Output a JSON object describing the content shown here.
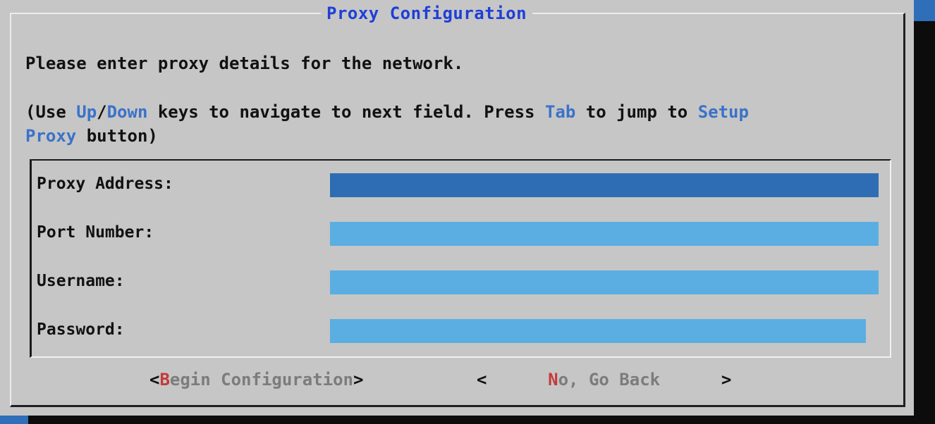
{
  "dialog": {
    "title": "Proxy Configuration",
    "intro": "Please enter proxy details for the network.",
    "help": {
      "p1": "(Use ",
      "up": "Up",
      "slash": "/",
      "down": "Down",
      "p2": " keys to navigate to next field. Press ",
      "tab": "Tab",
      "p3": " to jump to ",
      "setup": "Setup",
      "proxy": "Proxy",
      "p4": " button)"
    }
  },
  "fields": {
    "proxy_address": {
      "label": "Proxy Address:",
      "value": ""
    },
    "port_number": {
      "label": "Port Number:",
      "value": ""
    },
    "username": {
      "label": "Username:",
      "value": ""
    },
    "password": {
      "label": "Password:",
      "value": ""
    }
  },
  "buttons": {
    "begin": {
      "open": "<",
      "hotkey": "B",
      "rest": "egin Configuration",
      "close": ">"
    },
    "back": {
      "open": "<",
      "hotkey": "N",
      "rest": "o, Go Back",
      "close": ">"
    }
  },
  "colors": {
    "title": "#1f3fd6",
    "highlight_text": "#3a72c9",
    "input_bg": "#5aaee2",
    "input_active_bg": "#2e6db3",
    "dialog_bg": "#c6c6c6",
    "hotkey": "#c43a3a"
  }
}
